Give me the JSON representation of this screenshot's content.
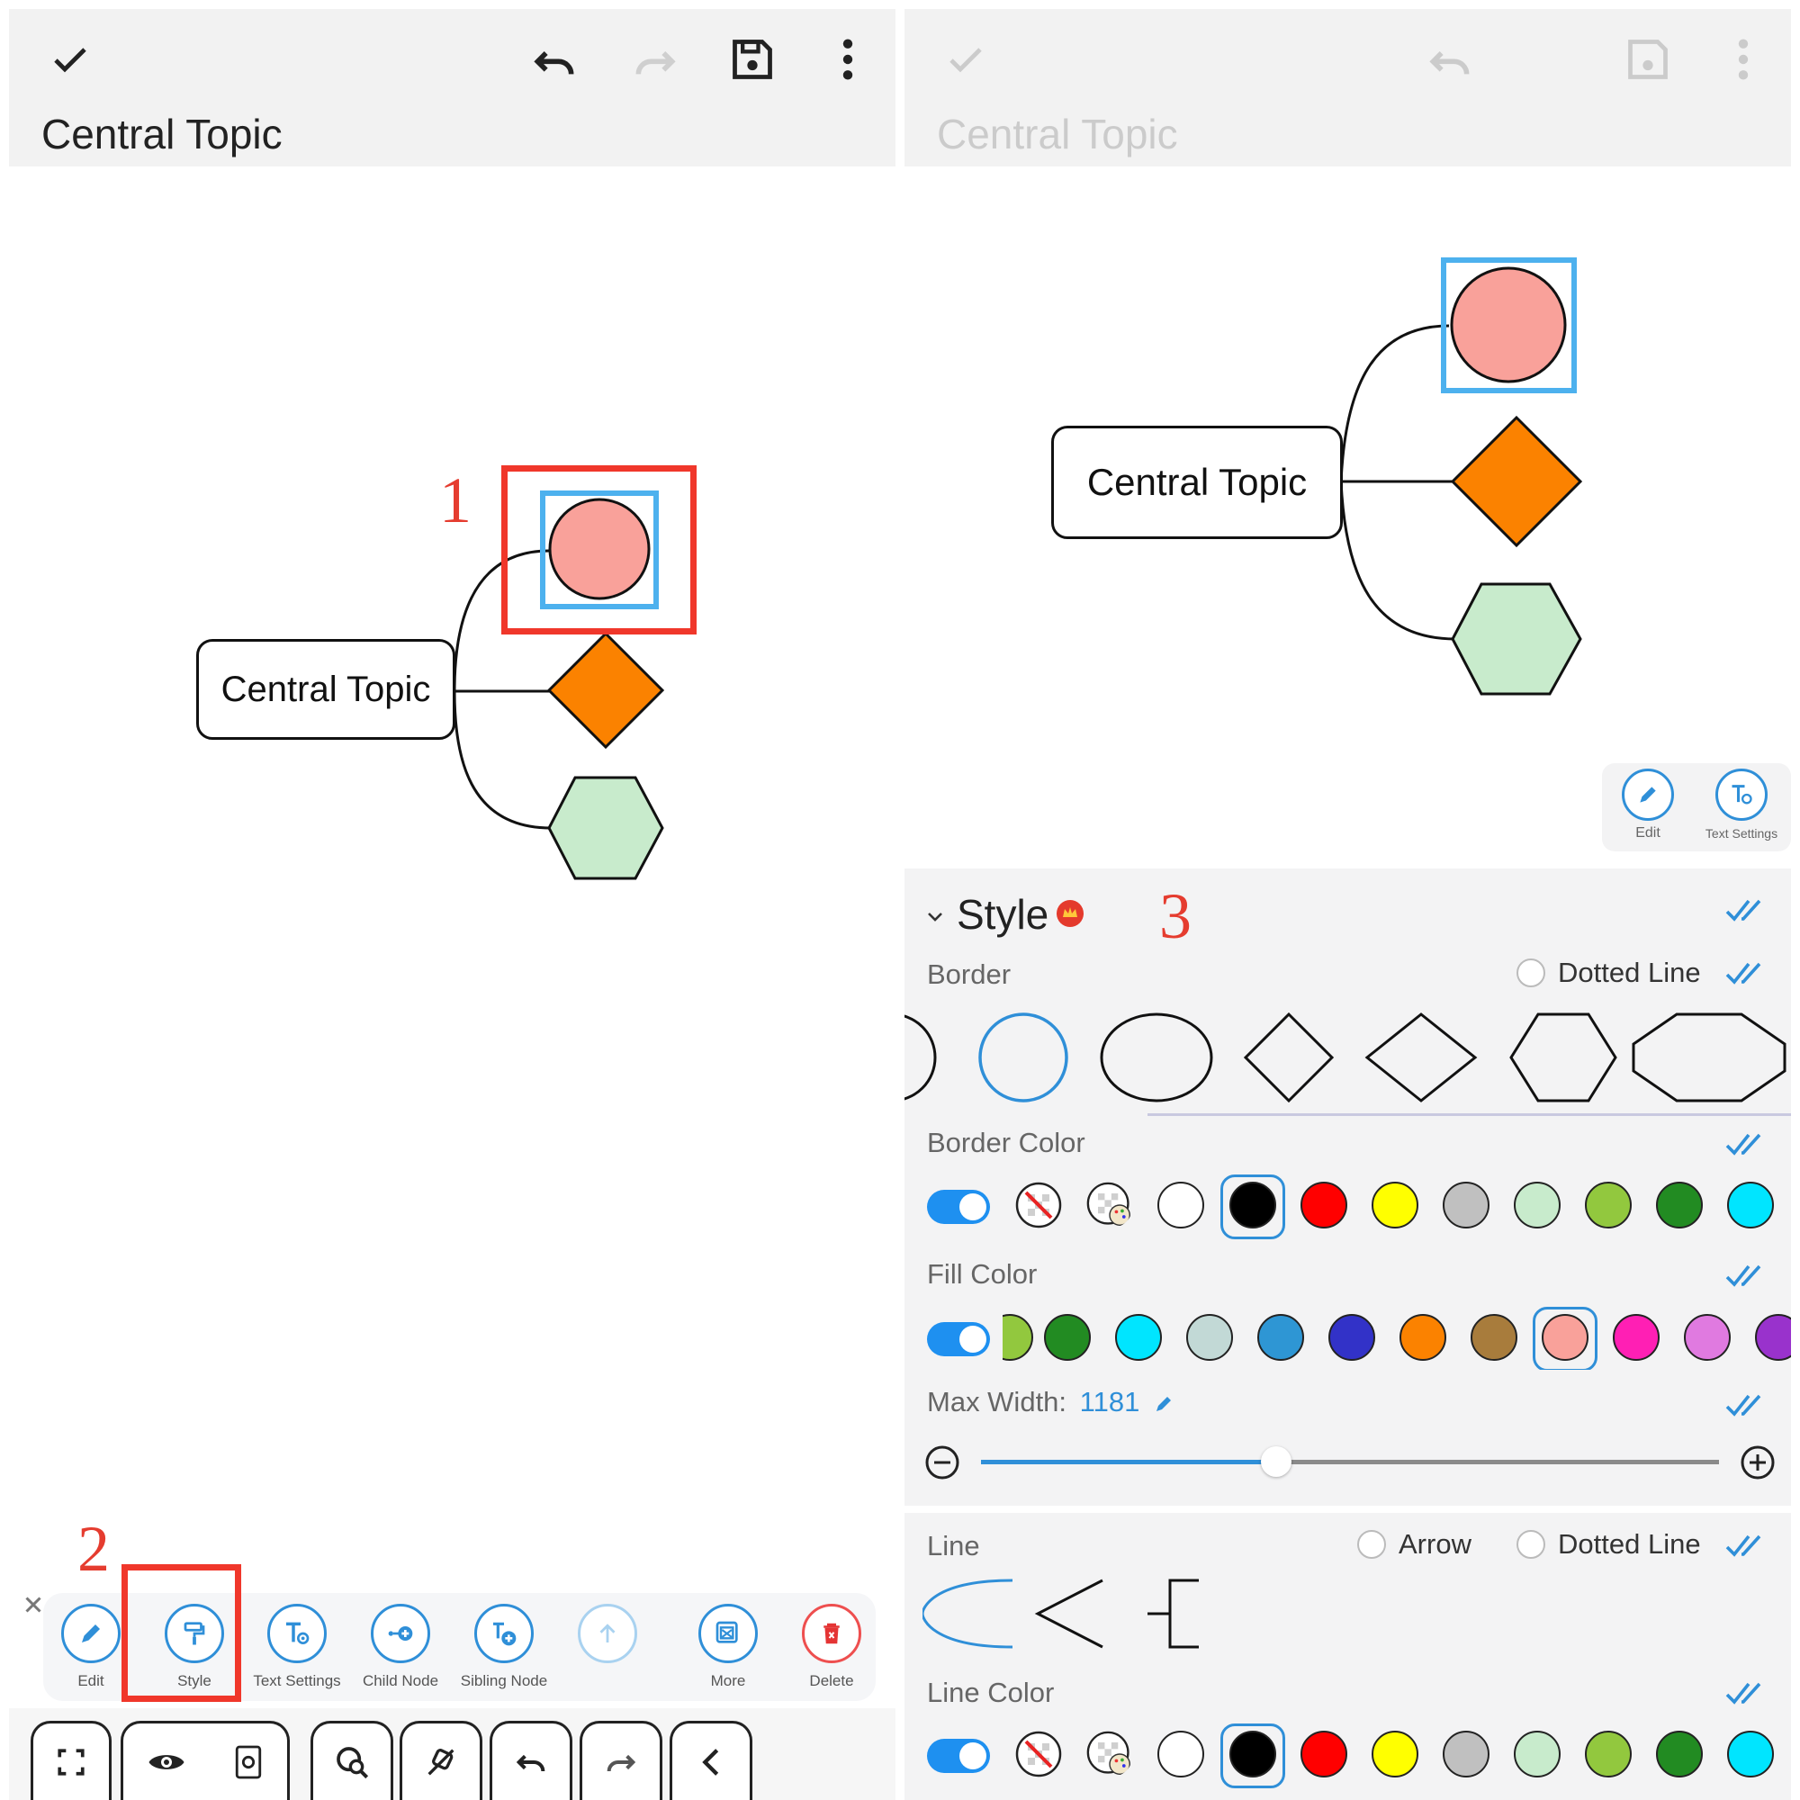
{
  "left": {
    "title": "Central Topic",
    "central_node": "Central Topic",
    "step1": "1",
    "step2": "2",
    "tools": [
      {
        "label": "Edit"
      },
      {
        "label": "Style"
      },
      {
        "label": "Text Settings"
      },
      {
        "label": "Child Node"
      },
      {
        "label": "Sibling Node"
      },
      {
        "label": ""
      },
      {
        "label": "More"
      },
      {
        "label": "Delete"
      }
    ]
  },
  "right": {
    "title": "Central Topic",
    "central_node": "Central Topic",
    "mini_tools": [
      {
        "label": "Edit"
      },
      {
        "label": "Text Settings"
      }
    ],
    "step3": "3",
    "style": {
      "heading": "Style",
      "border_label": "Border",
      "dotted_line": "Dotted Line",
      "border_color_label": "Border Color",
      "fill_color_label": "Fill Color",
      "max_width_label": "Max Width:",
      "max_width_value": "1181",
      "max_width_fraction": 0.4,
      "line_label": "Line",
      "arrow": "Arrow",
      "line_dotted": "Dotted Line",
      "line_color_label": "Line Color"
    }
  },
  "colors": {
    "accent": "#2f8fd8",
    "highlight_red": "#f0372b",
    "circle_fill": "#f9a19a",
    "diamond_fill": "#fb8200",
    "hexagon_fill": "#c8ebcc",
    "selection_blue": "#4db1ee",
    "border_swatches": [
      "#ffffff",
      "#000000",
      "#ff0000",
      "#ffff00",
      "#c0c0c0",
      "#c8ebcc",
      "#92c83e",
      "#228b22",
      "#00e5ff"
    ],
    "fill_swatches": [
      "#92c83e",
      "#228b22",
      "#00e5ff",
      "#c2d9d6",
      "#2e96d4",
      "#3232c8",
      "#fb8200",
      "#a87c3c",
      "#f9a19a",
      "#ff1fb4",
      "#e07ae0",
      "#9932cc"
    ]
  }
}
